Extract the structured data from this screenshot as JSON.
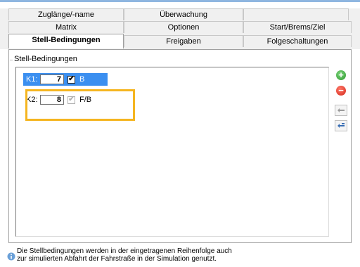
{
  "tabs": {
    "row1": [
      "Zuglänge/-name",
      "Überwachung",
      ""
    ],
    "row2": [
      {
        "label": "Matrix",
        "mnemonic": "M"
      },
      {
        "label": "Optionen",
        "mnemonic": "O"
      },
      {
        "label": "Start/Brems/Ziel",
        "mnemonic": "S"
      }
    ],
    "row3": [
      {
        "label": "Stell-Bedingungen",
        "mnemonic": "B",
        "active": true
      },
      {
        "label": "Freigaben",
        "mnemonic": "F"
      },
      {
        "label": "Folgeschaltungen",
        "mnemonic": "F"
      }
    ]
  },
  "group": {
    "title": "Stell-Bedingungen"
  },
  "rows": [
    {
      "label": "K1:",
      "number": "7",
      "checked": true,
      "flag": "B",
      "selected": true
    },
    {
      "label": "K2:",
      "number": "8",
      "checked": true,
      "flag": "F/B",
      "selected": false
    }
  ],
  "side_buttons": [
    "add-icon",
    "remove-icon",
    "move-up-icon",
    "move-down-icon"
  ],
  "colors": {
    "selection": "#3b8ff0",
    "highlight": "#f5b520",
    "add": "#2f9b2f",
    "remove": "#d3261a"
  },
  "footer": {
    "line1": "Die Stellbedingungen werden in der eingetragenen Reihenfolge auch",
    "line2": "zur simulierten Abfahrt der Fahrstraße in der Simulation genutzt.",
    "icon": "info-icon"
  }
}
